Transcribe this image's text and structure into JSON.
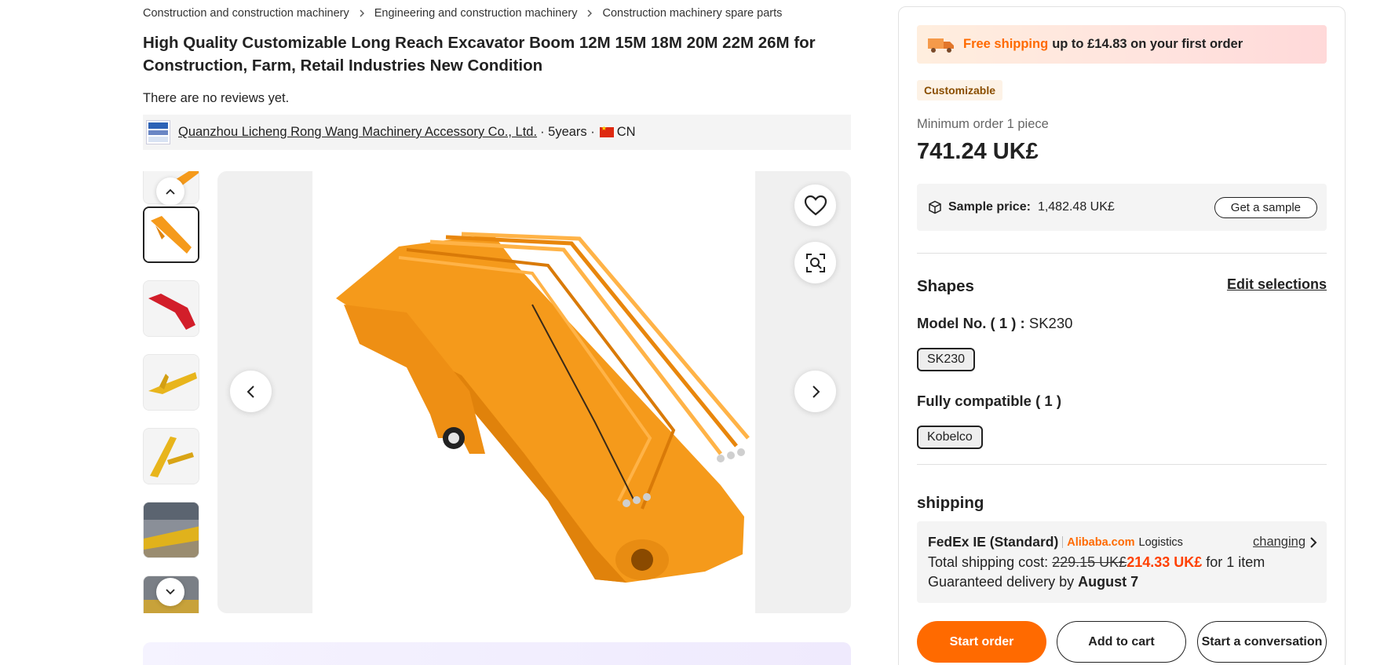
{
  "breadcrumb": [
    "Construction and construction machinery",
    "Engineering and construction machinery",
    "Construction machinery spare parts"
  ],
  "product": {
    "title": "High Quality Customizable Long Reach Excavator Boom 12M 15M 18M 20M 22M 26M for Construction, Farm, Retail Industries New Condition",
    "reviews": "There are no reviews yet."
  },
  "supplier": {
    "name": "Quanzhou Licheng Rong Wang Machinery Accessory Co., Ltd.",
    "years": "· 5years ·",
    "country": "CN"
  },
  "gallery": {
    "active_index": 0,
    "thumb_count": 6
  },
  "purchase": {
    "promo_highlight": "Free shipping",
    "promo_rest": "up to £14.83 on your first order",
    "tag": "Customizable",
    "min_order": "Minimum order 1 piece",
    "price": "741.24 UK£",
    "sample_label": "Sample price:",
    "sample_value": "1,482.48 UK£",
    "sample_button": "Get a sample"
  },
  "selections": {
    "title": "Shapes",
    "edit": "Edit selections",
    "model_label": "Model No. ( 1 ) :",
    "model_value": "SK230",
    "model_chip": "SK230",
    "compat_title": "Fully compatible ( 1 )",
    "compat_chip": "Kobelco"
  },
  "shipping": {
    "title": "shipping",
    "carrier": "FedEx IE (Standard)",
    "logo_text": "Alibaba.com",
    "logistics": "Logistics",
    "change": "changing",
    "cost_label": "Total shipping cost:",
    "old_cost": "229.15 UK£",
    "new_cost": "214.33 UK£",
    "cost_suffix": "for 1 item",
    "delivery_label": "Guaranteed delivery by",
    "delivery_date": "August 7"
  },
  "actions": {
    "start_order": "Start order",
    "add_to_cart": "Add to cart",
    "start_conversation": "Start a conversation"
  },
  "colors": {
    "accent": "#ff6a00",
    "price_discount": "#ff4000",
    "boom_orange": "#f59a1b"
  }
}
